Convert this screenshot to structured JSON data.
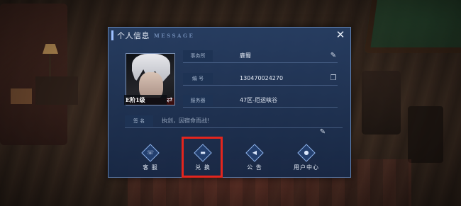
{
  "dialog": {
    "title": "个人信息",
    "subtitle": "MESSAGE",
    "close_label": "✕"
  },
  "profile": {
    "rank_badge": "E阶1级",
    "switch_icon": "⇄",
    "rows": [
      {
        "label": "事务所",
        "value": "鹿蜀",
        "icon": "edit-icon",
        "glyph": "✎"
      },
      {
        "label": "编  号",
        "value": "130470024270",
        "icon": "copy-icon",
        "glyph": "❐"
      },
      {
        "label": "服务器",
        "value": "47区-厄运峡谷",
        "icon": "",
        "glyph": ""
      }
    ],
    "signature": {
      "label": "签  名",
      "placeholder": "执剑，因宿命而战!",
      "edit_glyph": "✎"
    }
  },
  "buttons": [
    {
      "label": "客 服",
      "icon": "customer-service-icon",
      "glyph": "☏"
    },
    {
      "label": "兑 换",
      "icon": "exchange-icon",
      "glyph": "▬"
    },
    {
      "label": "公 告",
      "icon": "announcement-icon",
      "glyph": "◀"
    },
    {
      "label": "用户中心",
      "icon": "user-center-icon",
      "glyph": "●"
    }
  ],
  "colors": {
    "dialog_bg": "#263e64",
    "accent": "#8fb3ea",
    "highlight": "#e4251d"
  }
}
